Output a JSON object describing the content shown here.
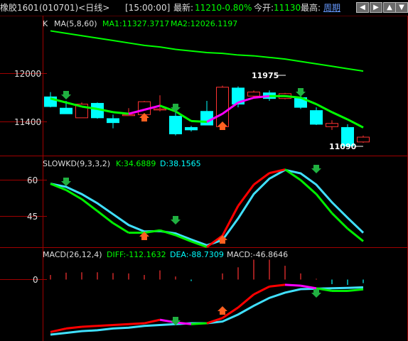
{
  "header": {
    "symbol": "橡胶1601",
    "code_period": "(010701)<日线>",
    "time": "[15:00:00]",
    "latest_label": "最新:",
    "latest_value": "11210",
    "change": "-0.80%",
    "open_label": "今开:",
    "open_value": "11130",
    "high_label": "最高:",
    "period_link": "周期"
  },
  "toolbar_icons": [
    "scroll-left-icon",
    "scroll-right-icon",
    "zoom-in-icon",
    "zoom-out-icon"
  ],
  "colors": {
    "up": "#ff3232",
    "down": "#00ffff",
    "ma1": "#00ff00",
    "ma2": "#00ff00",
    "line_red": "#ff0000",
    "line_magenta": "#ff00ff",
    "line_green": "#00ee00",
    "line_cyan": "#40e0ff",
    "grid": "#a00000",
    "label": "#00ff00",
    "highlight": "#ffff00"
  },
  "panels": {
    "kline": {
      "prefix": "K",
      "title": "MA(5,8,60)",
      "ma1_label": "MA1:11327.3717",
      "ma2_label": "MA2:12026.1197",
      "axis_labels": [
        "12000",
        "11400"
      ],
      "high_mark": "11975",
      "low_mark": "11090"
    },
    "kd": {
      "title": "SLOWKD(9,3,3,2)",
      "k_label": "K:34.6889",
      "d_label": "D:38.1565",
      "axis_labels": [
        "60",
        "45"
      ]
    },
    "macd": {
      "title": "MACD(26,12,4)",
      "diff_label": "DIFF:-112.1632",
      "dea_label": "DEA:-88.7309",
      "macd_label": "MACD:-46.8646",
      "axis_labels": [
        "0"
      ]
    }
  },
  "chart_data": {
    "type": "candlestick",
    "price_axis_ticks": [
      12000,
      11400
    ],
    "candles": [
      {
        "o": 11710,
        "h": 11770,
        "l": 11580,
        "c": 11590
      },
      {
        "o": 11570,
        "h": 11660,
        "l": 11500,
        "c": 11500
      },
      {
        "o": 11450,
        "h": 11640,
        "l": 11450,
        "c": 11620
      },
      {
        "o": 11630,
        "h": 11640,
        "l": 11440,
        "c": 11450
      },
      {
        "o": 11440,
        "h": 11490,
        "l": 11320,
        "c": 11390
      },
      {
        "o": 11490,
        "h": 11570,
        "l": 11480,
        "c": 11490
      },
      {
        "o": 11490,
        "h": 11660,
        "l": 11480,
        "c": 11650
      },
      {
        "o": 11550,
        "h": 11730,
        "l": 11530,
        "c": 11560
      },
      {
        "o": 11470,
        "h": 11590,
        "l": 11230,
        "c": 11250
      },
      {
        "o": 11330,
        "h": 11350,
        "l": 11280,
        "c": 11300
      },
      {
        "o": 11530,
        "h": 11660,
        "l": 11360,
        "c": 11360
      },
      {
        "o": 11340,
        "h": 11850,
        "l": 11340,
        "c": 11830
      },
      {
        "o": 11820,
        "h": 11840,
        "l": 11580,
        "c": 11620
      },
      {
        "o": 11720,
        "h": 11790,
        "l": 11700,
        "c": 11770
      },
      {
        "o": 11760,
        "h": 11790,
        "l": 11660,
        "c": 11690
      },
      {
        "o": 11690,
        "h": 11760,
        "l": 11680,
        "c": 11750
      },
      {
        "o": 11700,
        "h": 11730,
        "l": 11560,
        "c": 11580
      },
      {
        "o": 11540,
        "h": 11580,
        "l": 11360,
        "c": 11370
      },
      {
        "o": 11340,
        "h": 11420,
        "l": 11300,
        "c": 11380
      },
      {
        "o": 11330,
        "h": 11370,
        "l": 11090,
        "c": 11100
      },
      {
        "o": 11150,
        "h": 11230,
        "l": 11140,
        "c": 11210
      }
    ],
    "ma60": [
      12530,
      12500,
      12470,
      12440,
      12410,
      12380,
      12350,
      12330,
      12300,
      12280,
      12260,
      12250,
      12230,
      12220,
      12200,
      12180,
      12150,
      12120,
      12090,
      12060,
      12030
    ],
    "ma5": [
      11690,
      11640,
      11590,
      11560,
      11520,
      11500,
      11550,
      11600,
      11530,
      11410,
      11400,
      11500,
      11640,
      11700,
      11720,
      11720,
      11700,
      11620,
      11520,
      11430,
      11330
    ],
    "slowkd_k": [
      58.5,
      55.9,
      52.1,
      47.2,
      42.2,
      38.2,
      38.2,
      39.2,
      37.2,
      34.6,
      32.3,
      37.0,
      49.3,
      58.1,
      62.9,
      64.4,
      60.0,
      54.2,
      46.3,
      39.9,
      34.7
    ],
    "slowkd_d": [
      58.5,
      57.2,
      54.2,
      50.4,
      45.9,
      41.4,
      38.7,
      38.9,
      37.9,
      35.4,
      33.0,
      35.2,
      44.1,
      54.2,
      60.6,
      64.2,
      62.8,
      58.1,
      50.8,
      44.4,
      38.2
    ],
    "macd_dif": [
      -600,
      -560,
      -540,
      -530,
      -520,
      -510,
      -500,
      -460,
      -490,
      -510,
      -500,
      -440,
      -320,
      -170,
      -80,
      -60,
      -70,
      -100,
      -130,
      -130,
      -112
    ],
    "macd_dea": [
      -630,
      -610,
      -590,
      -580,
      -560,
      -550,
      -530,
      -520,
      -510,
      -500,
      -500,
      -480,
      -400,
      -300,
      -210,
      -150,
      -110,
      -105,
      -100,
      -95,
      -89
    ],
    "macd_hist": [
      60,
      90,
      95,
      95,
      85,
      80,
      60,
      120,
      40,
      -20,
      0,
      80,
      160,
      260,
      260,
      180,
      80,
      10,
      -60,
      -70,
      -47
    ]
  }
}
